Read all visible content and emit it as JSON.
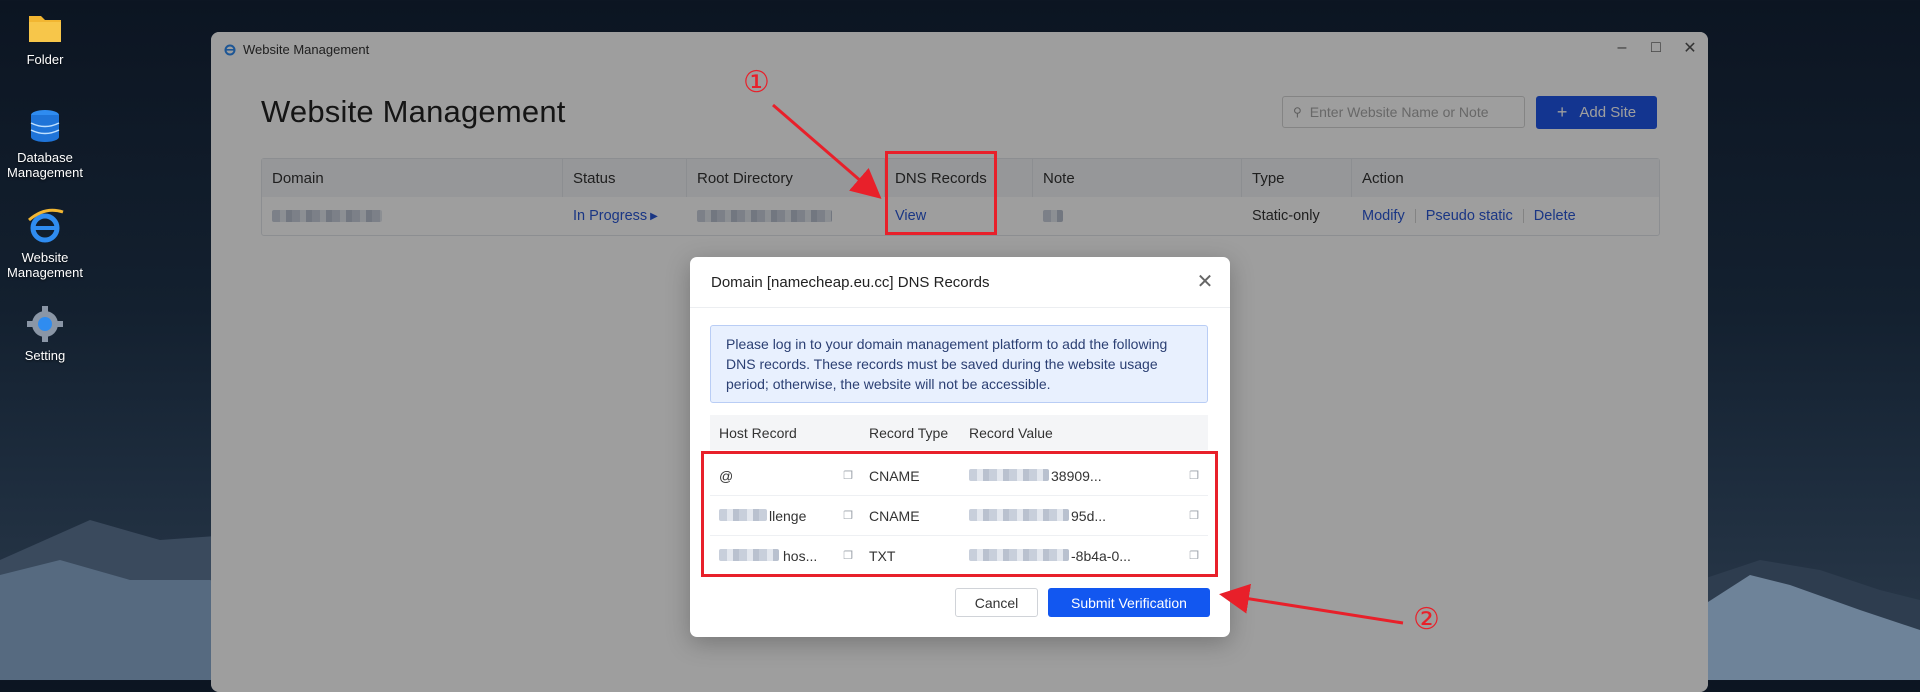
{
  "desktop": {
    "icons": [
      {
        "label": "Folder"
      },
      {
        "label": "Database Management"
      },
      {
        "label": "Website Management"
      },
      {
        "label": "Setting"
      }
    ]
  },
  "window": {
    "title": "Website Management",
    "page_title": "Website Management",
    "search_placeholder": "Enter Website Name or Note",
    "add_button": "Add Site",
    "columns": [
      "Domain",
      "Status",
      "Root Directory",
      "DNS Records",
      "Note",
      "Type",
      "Action"
    ],
    "row": {
      "status": "In Progress",
      "dns_link": "View",
      "type": "Static-only",
      "actions": [
        "Modify",
        "Pseudo static",
        "Delete"
      ]
    }
  },
  "dialog": {
    "title": "Domain [namecheap.eu.cc] DNS Records",
    "notice": "Please log in to your domain management platform to add the following DNS records. These records must be saved during the website usage period; otherwise, the website will not be accessible.",
    "columns": [
      "Host Record",
      "Record Type",
      "Record Value"
    ],
    "records": [
      {
        "host": "@",
        "type": "CNAME",
        "value": "38909..."
      },
      {
        "host": "llenge",
        "type": "CNAME",
        "value": "95d..."
      },
      {
        "host": "hos...",
        "type": "TXT",
        "value": "-8b4a-0..."
      }
    ],
    "cancel": "Cancel",
    "submit": "Submit Verification"
  },
  "annotations": [
    "①",
    "②"
  ],
  "colors": {
    "accent": "#1f56e8",
    "highlight": "#e8202a",
    "link": "#2a57d6"
  }
}
